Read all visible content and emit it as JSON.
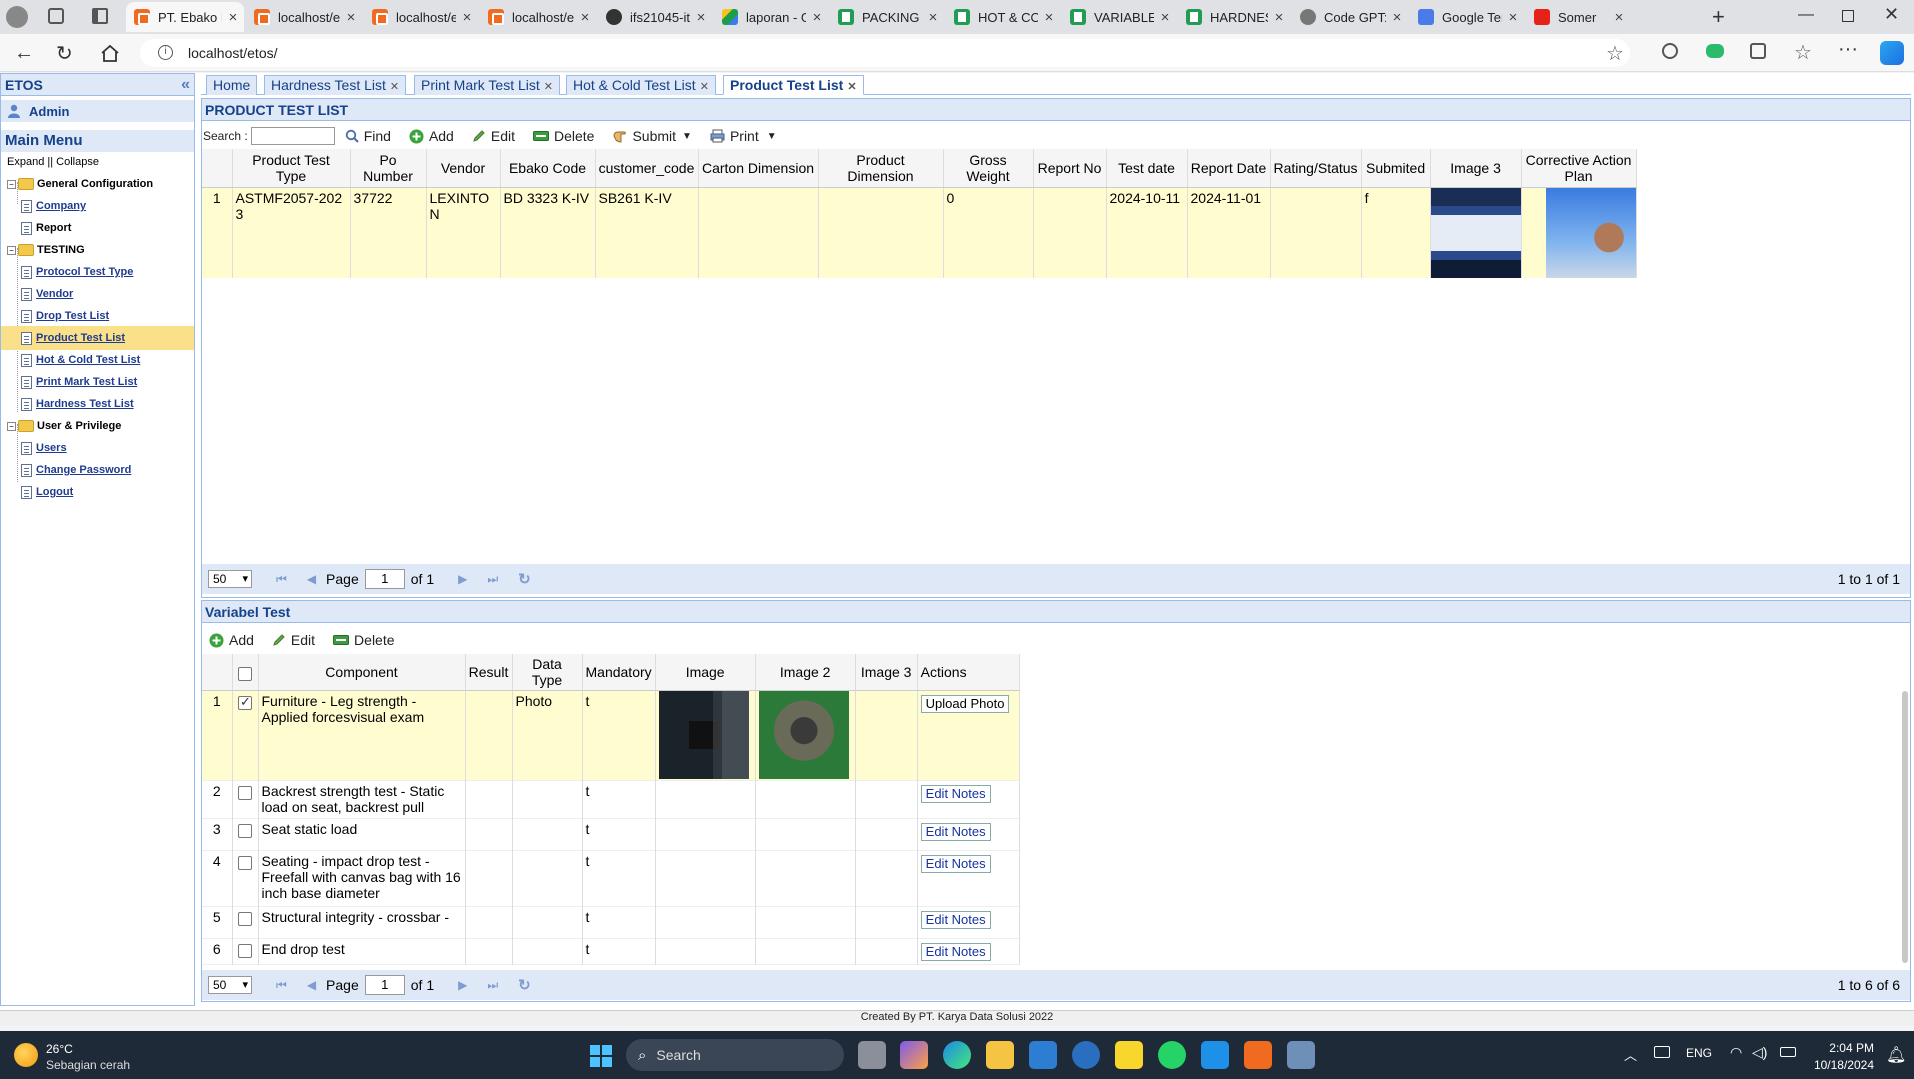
{
  "browser": {
    "tabs": [
      {
        "title": "PT. Ebako N",
        "favicon": "x-orange",
        "active": true
      },
      {
        "title": "localhost/e",
        "favicon": "x-orange"
      },
      {
        "title": "localhost/e",
        "favicon": "x-orange"
      },
      {
        "title": "localhost/e",
        "favicon": "x-orange"
      },
      {
        "title": "ifs21045-it",
        "favicon": "gh"
      },
      {
        "title": "laporan - G",
        "favicon": "drive"
      },
      {
        "title": "PACKING M",
        "favicon": "sheets"
      },
      {
        "title": "HOT & COL",
        "favicon": "sheets"
      },
      {
        "title": "VARIABLE A",
        "favicon": "sheets"
      },
      {
        "title": "HARDNESS",
        "favicon": "sheets"
      },
      {
        "title": "Code GPT:",
        "favicon": "gpt"
      },
      {
        "title": "Google Ter",
        "favicon": "gt"
      },
      {
        "title": "Somer",
        "favicon": "yt"
      }
    ],
    "url": "localhost/etos/"
  },
  "sidebar": {
    "title": "ETOS",
    "user": "Admin",
    "menu_title": "Main Menu",
    "expand": "Expand",
    "separator": "||",
    "collapse": "Collapse",
    "items": [
      {
        "label": "General Configuration",
        "type": "folder"
      },
      {
        "label": "Company",
        "type": "link"
      },
      {
        "label": "Report",
        "type": "leaf"
      },
      {
        "label": "TESTING",
        "type": "folder"
      },
      {
        "label": "Protocol Test Type",
        "type": "link"
      },
      {
        "label": "Vendor",
        "type": "link"
      },
      {
        "label": "Drop Test List",
        "type": "link"
      },
      {
        "label": "Product Test List",
        "type": "link",
        "selected": true
      },
      {
        "label": "Hot & Cold Test List",
        "type": "link"
      },
      {
        "label": "Print Mark Test List",
        "type": "link"
      },
      {
        "label": "Hardness Test List",
        "type": "link"
      },
      {
        "label": "User & Privilege",
        "type": "folder"
      },
      {
        "label": "Users",
        "type": "link"
      },
      {
        "label": "Change Password",
        "type": "link"
      },
      {
        "label": "Logout",
        "type": "link"
      }
    ]
  },
  "page_tabs": [
    {
      "label": "Home",
      "closable": false
    },
    {
      "label": "Hardness Test List",
      "closable": true
    },
    {
      "label": "Print Mark Test List",
      "closable": true
    },
    {
      "label": "Hot & Cold Test List",
      "closable": true
    },
    {
      "label": "Product Test List",
      "closable": true,
      "active": true
    }
  ],
  "product_panel": {
    "title": "PRODUCT TEST LIST",
    "search_label": "Search :",
    "search_value": "",
    "toolbar": {
      "find": "Find",
      "add": "Add",
      "edit": "Edit",
      "delete": "Delete",
      "submit": "Submit",
      "print": "Print"
    },
    "columns": [
      "Product Test Type",
      "Po Number",
      "Vendor",
      "Ebako Code",
      "customer_code",
      "Carton Dimension",
      "Product Dimension",
      "Gross Weight",
      "Report No",
      "Test date",
      "Report Date",
      "Rating/Status",
      "Submited",
      "Image 3",
      "Corrective Action Plan"
    ],
    "rows": [
      {
        "n": "1",
        "product_test_type": "ASTMF2057-2023",
        "po_number": "37722",
        "vendor": "LEXINTON",
        "ebako_code": "BD 3323 K-IV",
        "customer_code": "SB261 K-IV",
        "carton_dimension": "",
        "product_dimension": "",
        "gross_weight": "0",
        "report_no": "",
        "test_date": "2024-10-11",
        "report_date": "2024-11-01",
        "rating_status": "",
        "submited": "f"
      }
    ],
    "pager": {
      "page_size": "50",
      "page_label": "Page",
      "page": "1",
      "of_label": "of 1",
      "summary": "1 to 1 of 1"
    }
  },
  "variable_panel": {
    "title": "Variabel Test",
    "toolbar": {
      "add": "Add",
      "edit": "Edit",
      "delete": "Delete"
    },
    "columns": [
      "Component",
      "Result",
      "Data Type",
      "Mandatory",
      "Image",
      "Image 2",
      "Image 3",
      "Actions"
    ],
    "rows": [
      {
        "n": "1",
        "checked": true,
        "component": "Furniture - Leg strength - Applied forcesvisual exam",
        "result": "",
        "data_type": "Photo",
        "mandatory": "t",
        "action": "Upload Photo",
        "has_images": true
      },
      {
        "n": "2",
        "checked": false,
        "component": "Backrest strength test - Static load on seat, backrest pull",
        "result": "",
        "data_type": "",
        "mandatory": "t",
        "action": "Edit Notes"
      },
      {
        "n": "3",
        "checked": false,
        "component": "Seat static load",
        "result": "",
        "data_type": "",
        "mandatory": "t",
        "action": "Edit Notes"
      },
      {
        "n": "4",
        "checked": false,
        "component": "Seating - impact drop test - Freefall with canvas bag with 16 inch base diameter",
        "result": "",
        "data_type": "",
        "mandatory": "t",
        "action": "Edit Notes"
      },
      {
        "n": "5",
        "checked": false,
        "component": "Structural integrity - crossbar -",
        "result": "",
        "data_type": "",
        "mandatory": "t",
        "action": "Edit Notes"
      },
      {
        "n": "6",
        "checked": false,
        "component": "End drop test",
        "result": "",
        "data_type": "",
        "mandatory": "t",
        "action": "Edit Notes"
      }
    ],
    "pager": {
      "page_size": "50",
      "page_label": "Page",
      "page": "1",
      "of_label": "of 1",
      "summary": "1 to 6 of 6"
    }
  },
  "footer": "Created By PT. Karya Data Solusi 2022",
  "taskbar": {
    "weather_temp": "26°C",
    "weather_desc": "Sebagian cerah",
    "search_placeholder": "Search",
    "lang": "ENG",
    "time": "2:04 PM",
    "date": "10/18/2024"
  },
  "colors": {
    "panel_header": "#dfe8f6",
    "border": "#99bbe8",
    "header_text": "#15428b",
    "selected_row": "#fffdd0",
    "selected_menu": "#fbe08a"
  }
}
